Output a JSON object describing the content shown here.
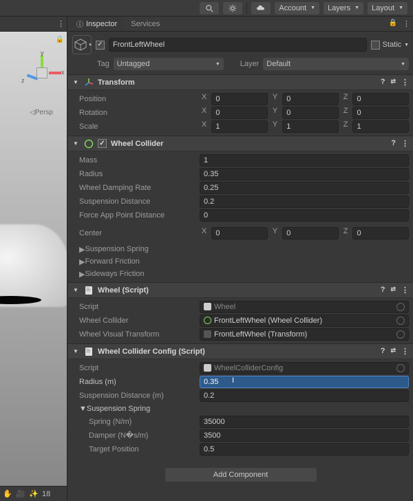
{
  "toolbar": {
    "account": "Account",
    "layers": "Layers",
    "layout": "Layout"
  },
  "scene": {
    "persp_label": "Persp",
    "fx_count": "18",
    "gizmo": {
      "x": "x",
      "y": "y",
      "z": "z"
    }
  },
  "panel_tabs": {
    "inspector": "Inspector",
    "services": "Services"
  },
  "gameobject": {
    "name": "FrontLeftWheel",
    "static_label": "Static",
    "tag_label": "Tag",
    "tag_value": "Untagged",
    "layer_label": "Layer",
    "layer_value": "Default"
  },
  "transform": {
    "title": "Transform",
    "position_label": "Position",
    "rotation_label": "Rotation",
    "scale_label": "Scale",
    "pos": {
      "x": "0",
      "y": "0",
      "z": "0"
    },
    "rot": {
      "x": "0",
      "y": "0",
      "z": "0"
    },
    "scale": {
      "x": "1",
      "y": "1",
      "z": "1"
    },
    "axes": {
      "x": "X",
      "y": "Y",
      "z": "Z"
    }
  },
  "wheel_collider": {
    "title": "Wheel Collider",
    "mass_label": "Mass",
    "mass": "1",
    "radius_label": "Radius",
    "radius": "0.35",
    "damping_label": "Wheel Damping Rate",
    "damping": "0.25",
    "susp_dist_label": "Suspension Distance",
    "susp_dist": "0.2",
    "force_app_label": "Force App Point Distance",
    "force_app": "0",
    "center_label": "Center",
    "center": {
      "x": "0",
      "y": "0",
      "z": "0"
    },
    "susp_spring_label": "Suspension Spring",
    "fwd_friction_label": "Forward Friction",
    "side_friction_label": "Sideways Friction"
  },
  "wheel_script": {
    "title": "Wheel (Script)",
    "script_label": "Script",
    "script_value": "Wheel",
    "wheel_collider_label": "Wheel Collider",
    "wheel_collider_value": "FrontLeftWheel (Wheel Collider)",
    "visual_label": "Wheel Visual Transform",
    "visual_value": "FrontLeftWheel (Transform)"
  },
  "collider_config": {
    "title": "Wheel Collider Config (Script)",
    "script_label": "Script",
    "script_value": "WheelColliderConfig",
    "radius_label": "Radius (m)",
    "radius": "0.35",
    "susp_dist_label": "Suspension Distance (m)",
    "susp_dist": "0.2",
    "susp_spring_label": "Suspension Spring",
    "spring_label": "Spring (N/m)",
    "spring": "35000",
    "damper_label": "Damper (N�s/m)",
    "damper": "3500",
    "target_label": "Target Position",
    "target": "0.5"
  },
  "add_component": "Add Component"
}
